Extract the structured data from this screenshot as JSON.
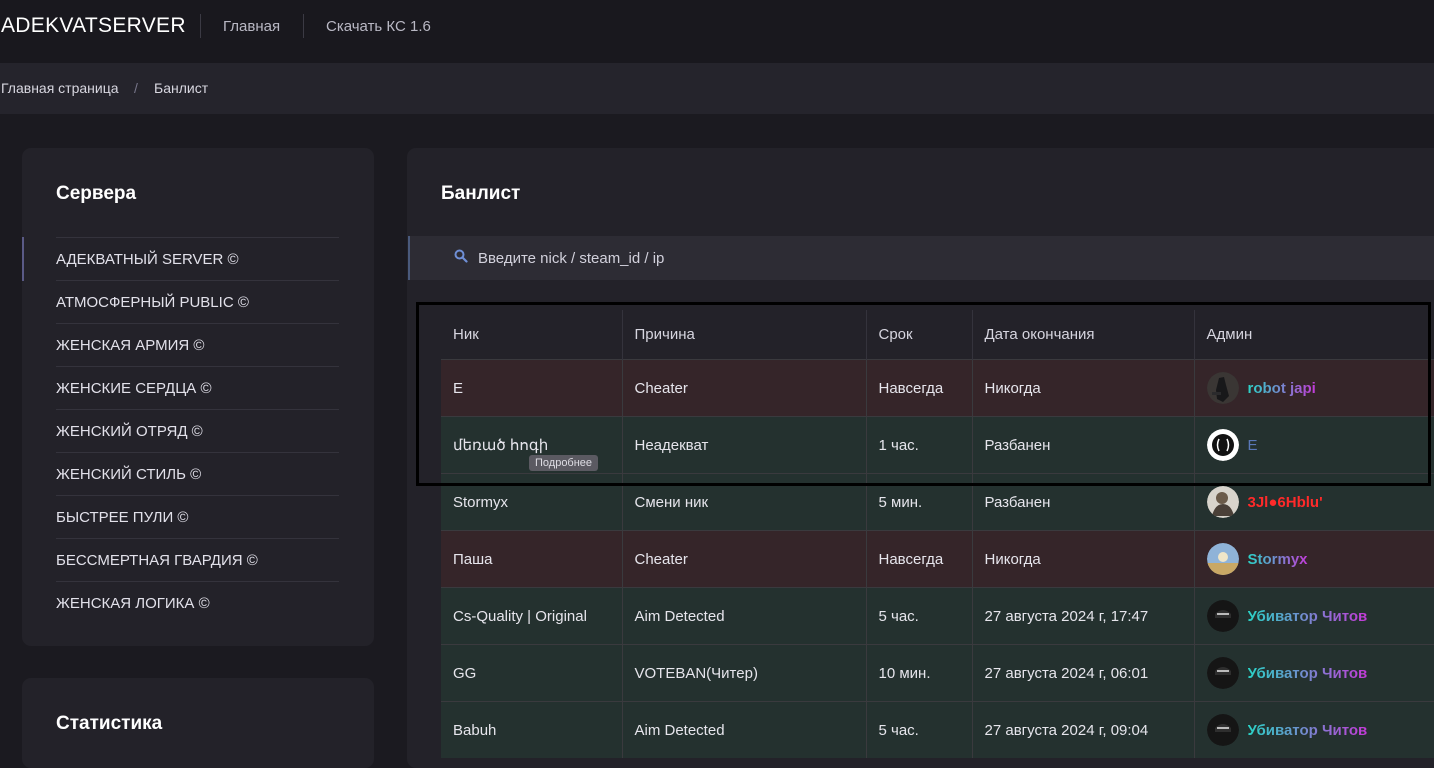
{
  "header": {
    "brand": "ADEKVATSERVER",
    "nav": [
      "Главная",
      "Скачать КС 1.6"
    ]
  },
  "breadcrumb": {
    "home": "Главная страница",
    "sep": "/",
    "current": "Банлист"
  },
  "servers_card": {
    "title": "Сервера",
    "items": [
      "АДЕКВАТНЫЙ SERVER ©",
      "АТМОСФЕРНЫЙ PUBLIC ©",
      "ЖЕНСКАЯ АРМИЯ ©",
      "ЖЕНСКИЕ СЕРДЦА ©",
      "ЖЕНСКИЙ ОТРЯД ©",
      "ЖЕНСКИЙ СТИЛЬ ©",
      "БЫСТРЕЕ ПУЛИ ©",
      "БЕССМЕРТНАЯ ГВАРДИЯ ©",
      "ЖЕНСКАЯ ЛОГИКА ©"
    ],
    "active_index": 0
  },
  "stats_card": {
    "title": "Статистика"
  },
  "banlist": {
    "title": "Банлист",
    "search_placeholder": "Введите nick / steam_id / ip",
    "columns": [
      "Ник",
      "Причина",
      "Срок",
      "Дата окончания",
      "Админ"
    ],
    "tooltip": "Подробнее",
    "rows": [
      {
        "nick": "E",
        "reason": "Cheater",
        "term": "Навсегда",
        "end": "Никогда",
        "admin": "robot japi",
        "permanent": true
      },
      {
        "nick": "մեռած հոգի",
        "reason": "Неадекват",
        "term": "1 час.",
        "end": "Разбанен",
        "admin": "E",
        "permanent": false
      },
      {
        "nick": "Stormyx",
        "reason": "Смени ник",
        "term": "5 мин.",
        "end": "Разбанен",
        "admin": "3Jl●6Hblu'",
        "permanent": false
      },
      {
        "nick": "Паша",
        "reason": "Cheater",
        "term": "Навсегда",
        "end": "Никогда",
        "admin": "Stormyx",
        "permanent": true
      },
      {
        "nick": "Cs-Quality | Original",
        "reason": "Aim Detected",
        "term": "5 час.",
        "end": "27 августа 2024 г, 17:47",
        "admin": "Убиватор Читов",
        "permanent": false
      },
      {
        "nick": "GG",
        "reason": "VOTEBAN(Читер)",
        "term": "10 мин.",
        "end": "27 августа 2024 г, 06:01",
        "admin": "Убиватор Читов",
        "permanent": false
      },
      {
        "nick": "Babuh",
        "reason": "Aim Detected",
        "term": "5 час.",
        "end": "27 августа 2024 г, 09:04",
        "admin": "Убиватор Читов",
        "permanent": false
      }
    ]
  },
  "colors": {
    "perm_term": "#e35a63",
    "temp_term": "#3fbf82",
    "perm_row": "#352529",
    "temp_row": "#24312f",
    "admin_gradient": [
      "#2ad3c7",
      "#c43ad8"
    ],
    "admin_red": "#ff2a2a"
  }
}
